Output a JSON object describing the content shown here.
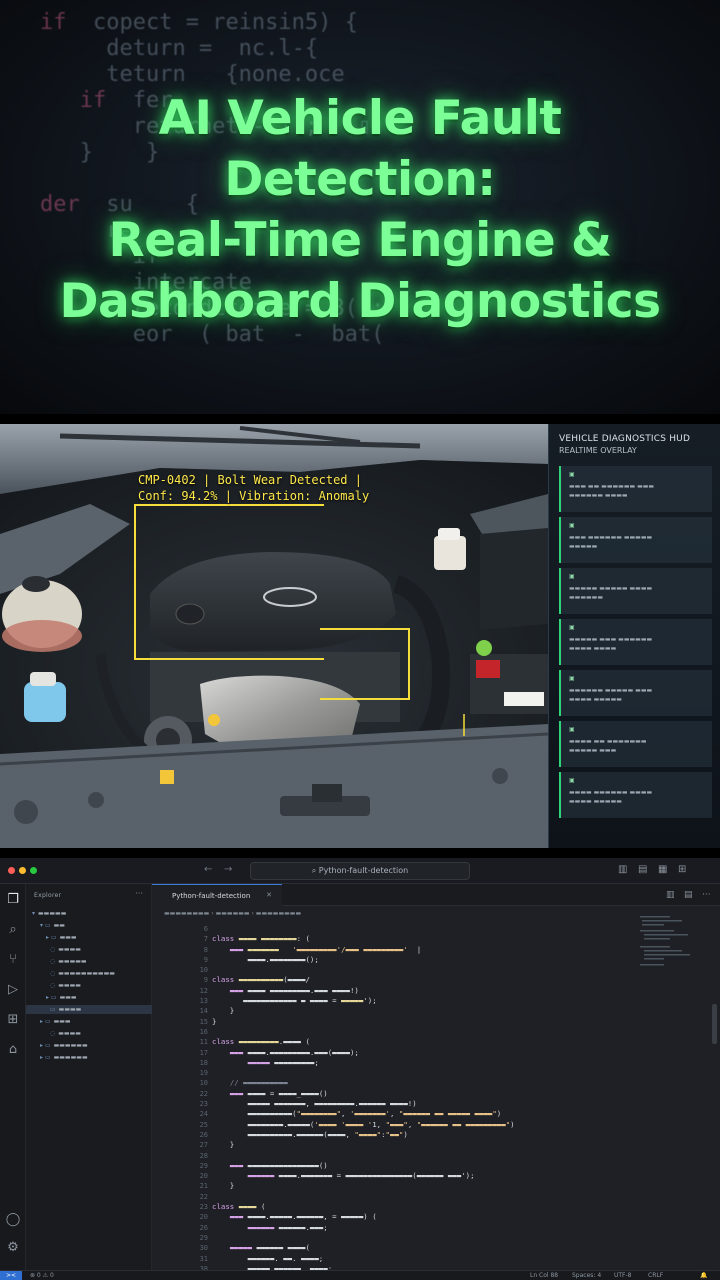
{
  "banner": {
    "title_line1": "AI Vehicle Fault",
    "title_line2": "Detection:",
    "title_line3": "Real-Time Engine &",
    "title_line4": "Dashboard Diagnostics"
  },
  "detection": {
    "label_line1": "CMP-0402 | Bolt Wear Detected |",
    "label_line2": "Conf: 94.2% | Vibration: Anomaly"
  },
  "hud": {
    "title": "VEHICLE DIAGNOSTICS HUD",
    "subtitle": "REALTIME OVERLAY",
    "accent": "#2fd37a"
  },
  "ide": {
    "search_label": "Python-fault-detection",
    "active_tab": "Python-fault-detection",
    "explorer_head": "Explorer",
    "remote_label": "><",
    "status_items": [
      "Ln Col 88",
      "Spaces: 4",
      "UTF-8",
      "CRLF"
    ]
  },
  "colors": {
    "title_glow": "#7dff97",
    "detection_box": "#f5dd3b",
    "hud_card_border": "#2fd37a",
    "vscode_tab_accent": "#3d7bd9"
  }
}
